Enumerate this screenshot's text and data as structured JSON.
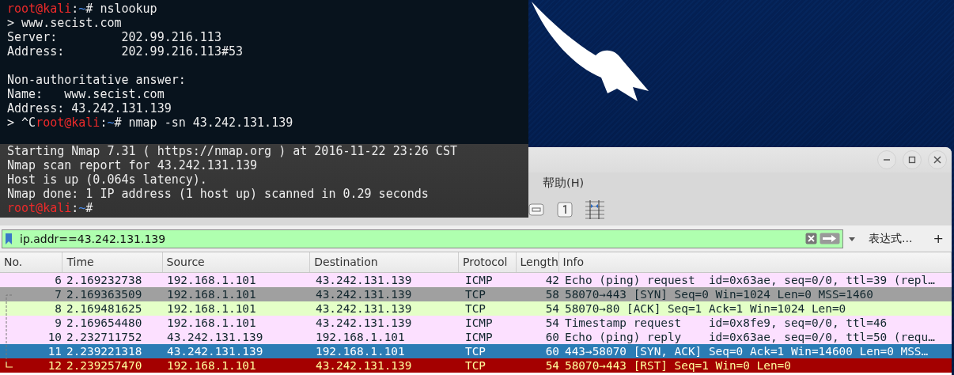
{
  "terminal": {
    "lines": [
      {
        "kind": "prompt",
        "segments": [
          {
            "kind": "user",
            "text": "root@kali"
          },
          {
            "kind": "plain",
            "text": ":"
          },
          {
            "kind": "path",
            "text": "~"
          },
          {
            "kind": "plain",
            "text": "# nslookup"
          }
        ]
      },
      {
        "kind": "output",
        "text": "> www.secist.com"
      },
      {
        "kind": "output",
        "text": "Server:         202.99.216.113"
      },
      {
        "kind": "output",
        "text": "Address:        202.99.216.113#53"
      },
      {
        "kind": "blank"
      },
      {
        "kind": "output",
        "text": "Non-authoritative answer:"
      },
      {
        "kind": "output",
        "text": "Name:   www.secist.com"
      },
      {
        "kind": "output",
        "text": "Address: 43.242.131.139"
      },
      {
        "kind": "prompt",
        "segments": [
          {
            "kind": "plain",
            "text": "> ^C"
          },
          {
            "kind": "user",
            "text": "root@kali"
          },
          {
            "kind": "plain",
            "text": ":"
          },
          {
            "kind": "path",
            "text": "~"
          },
          {
            "kind": "plain",
            "text": "# nmap -sn 43.242.131.139"
          }
        ]
      },
      {
        "kind": "blank"
      },
      {
        "kind": "output",
        "text": "Starting Nmap 7.31 ( https://nmap.org ) at 2016-11-22 23:26 CST"
      },
      {
        "kind": "output",
        "text": "Nmap scan report for 43.242.131.139"
      },
      {
        "kind": "output",
        "text": "Host is up (0.064s latency)."
      },
      {
        "kind": "output",
        "text": "Nmap done: 1 IP address (1 host up) scanned in 0.29 seconds"
      },
      {
        "kind": "prompt",
        "segments": [
          {
            "kind": "user",
            "text": "root@kali"
          },
          {
            "kind": "plain",
            "text": ":"
          },
          {
            "kind": "path",
            "text": "~"
          },
          {
            "kind": "plain",
            "text": "#"
          }
        ]
      }
    ]
  },
  "wireshark": {
    "menu": [
      "帮助(H)"
    ],
    "filter": {
      "value": "ip.addr==43.242.131.139",
      "expression_button": "表达式…",
      "add_button": "+"
    },
    "table": {
      "columns": [
        "No.",
        "Time",
        "Source",
        "Destination",
        "Protocol",
        "Length",
        "Info"
      ],
      "rows": [
        {
          "no": "6",
          "time": "2.169232738",
          "source": "192.168.1.101",
          "destination": "43.242.131.139",
          "protocol": "ICMP",
          "length": "42",
          "info": "Echo (ping) request  id=0x63ae, seq=0/0, ttl=39 (repl…",
          "color": "#fce0ff",
          "selected": false
        },
        {
          "no": "7",
          "time": "2.169363509",
          "source": "192.168.1.101",
          "destination": "43.242.131.139",
          "protocol": "TCP",
          "length": "58",
          "info": "58070→443 [SYN] Seq=0 Win=1024 Len=0 MSS=1460",
          "color": "#a0a0a0",
          "selected": false
        },
        {
          "no": "8",
          "time": "2.169481625",
          "source": "192.168.1.101",
          "destination": "43.242.131.139",
          "protocol": "TCP",
          "length": "54",
          "info": "58070→80 [ACK] Seq=1 Ack=1 Win=1024 Len=0",
          "color": "#e4ffc7",
          "selected": false
        },
        {
          "no": "9",
          "time": "2.169654480",
          "source": "192.168.1.101",
          "destination": "43.242.131.139",
          "protocol": "ICMP",
          "length": "54",
          "info": "Timestamp request    id=0x8fe9, seq=0/0, ttl=46",
          "color": "#fce0ff",
          "selected": false
        },
        {
          "no": "10",
          "time": "2.232711752",
          "source": "43.242.131.139",
          "destination": "192.168.1.101",
          "protocol": "ICMP",
          "length": "60",
          "info": "Echo (ping) reply    id=0x63ae, seq=0/0, ttl=50 (requ…",
          "color": "#fce0ff",
          "selected": false
        },
        {
          "no": "11",
          "time": "2.239221318",
          "source": "43.242.131.139",
          "destination": "192.168.1.101",
          "protocol": "TCP",
          "length": "60",
          "info": "443→58070 [SYN, ACK] Seq=0 Ack=1 Win=14600 Len=0 MSS…",
          "selected": true
        },
        {
          "no": "12",
          "time": "2.239257470",
          "source": "192.168.1.101",
          "destination": "43.242.131.139",
          "protocol": "TCP",
          "length": "54",
          "info": "58070→443 [RST] Seq=1 Win=0 Len=0",
          "color": "#a40000",
          "kind": "alert",
          "selected": false
        }
      ]
    }
  }
}
